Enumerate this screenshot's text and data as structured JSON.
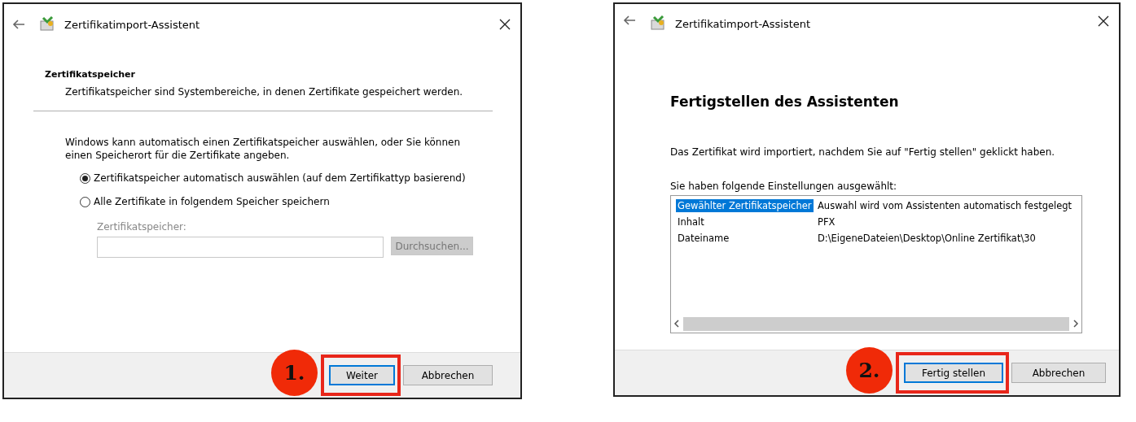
{
  "dialogs": [
    {
      "kind": "store",
      "title": "Zertifikatimport-Assistent",
      "section_title": "Zertifikatspeicher",
      "section_subtitle": "Zertifikatspeicher sind Systembereiche, in denen Zertifikate gespeichert werden.",
      "description": "Windows kann automatisch einen Zertifikatspeicher auswählen, oder Sie können einen Speicherort für die Zertifikate angeben.",
      "options": [
        {
          "label": "Zertifikatspeicher automatisch auswählen (auf dem Zertifikattyp basierend)",
          "selected": true
        },
        {
          "label": "Alle Zertifikate in folgendem Speicher speichern",
          "selected": false
        }
      ],
      "store_field": {
        "label": "Zertifikatspeicher:",
        "disabled": true,
        "browse": "Durchsuchen..."
      },
      "buttons": [
        {
          "label": "Weiter",
          "default": true,
          "highlighted": true,
          "callout": "1."
        },
        {
          "label": "Abbrechen",
          "default": false,
          "highlighted": false
        }
      ]
    },
    {
      "kind": "finish",
      "title": "Zertifikatimport-Assistent",
      "heading": "Fertigstellen des Assistenten",
      "description": "Das Zertifikat wird importiert, nachdem Sie auf \"Fertig stellen\" geklickt haben.",
      "list_label": "Sie haben folgende Einstellungen ausgewählt:",
      "settings": [
        {
          "name": "Gewählter Zertifikatspeicher",
          "value": "Auswahl wird vom Assistenten automatisch festgelegt",
          "selected": true
        },
        {
          "name": "Inhalt",
          "value": "PFX",
          "selected": false
        },
        {
          "name": "Dateiname",
          "value": "D:\\EigeneDateien\\Desktop\\Online Zertifikat\\30",
          "selected": false
        }
      ],
      "buttons": [
        {
          "label": "Fertig stellen",
          "default": true,
          "highlighted": true,
          "callout": "2."
        },
        {
          "label": "Abbrechen",
          "default": false,
          "highlighted": false
        }
      ]
    }
  ]
}
